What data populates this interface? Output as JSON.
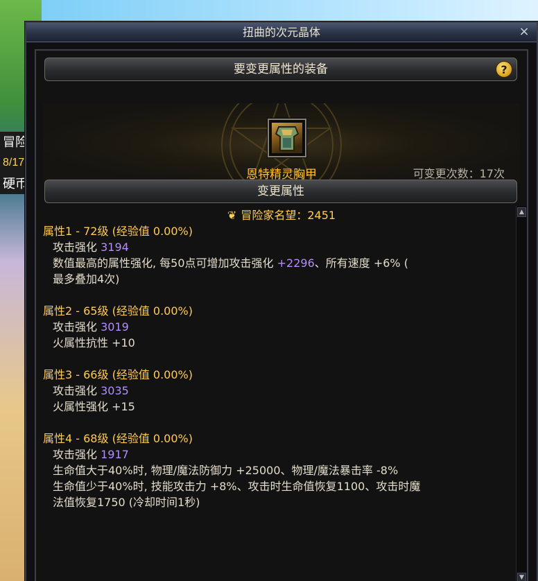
{
  "window": {
    "title": "扭曲的次元晶体",
    "close": "×"
  },
  "background": {
    "badge_line1": "冒险",
    "badge_line2": "8/17",
    "badge_line3": "硬币"
  },
  "equipment_section": {
    "title": "要变更属性的装备",
    "help": "?",
    "item_name": "恩特精灵胸甲",
    "change_count": "可变更次数：17次"
  },
  "attributes_section": {
    "title": "变更属性",
    "reputation": "冒险家名望：2451",
    "groups": [
      {
        "title": "属性1 - 72级 (经验值 0.00%)",
        "strength_label": "攻击强化",
        "strength_value": "3194",
        "lines": [
          "数值最高的属性强化, 每50点可增加攻击强化 ",
          "+2296",
          "、所有速度 +6% (",
          "最多叠加4次)"
        ]
      },
      {
        "title": "属性2 - 65级 (经验值 0.00%)",
        "strength_label": "攻击强化",
        "strength_value": "3019",
        "lines": [
          "火属性抗性 +10"
        ]
      },
      {
        "title": "属性3 - 66级 (经验值 0.00%)",
        "strength_label": "攻击强化",
        "strength_value": "3035",
        "lines": [
          "火属性强化 +15"
        ]
      },
      {
        "title": "属性4 - 68级 (经验值 0.00%)",
        "strength_label": "攻击强化",
        "strength_value": "1917",
        "lines": [
          "生命值大于40%时, 物理/魔法防御力 +25000、物理/魔法暴击率 -8%",
          "生命值少于40%时, 技能攻击力 +8%、攻击时生命值恢复1100、攻击时魔",
          "法值恢复1750 (冷却时间1秒)"
        ]
      }
    ]
  },
  "colors": {
    "gold_text": "#ffcc55",
    "item_name": "#ffbf2b",
    "purple_value": "#b48cff",
    "body_text": "#e4dccb"
  }
}
